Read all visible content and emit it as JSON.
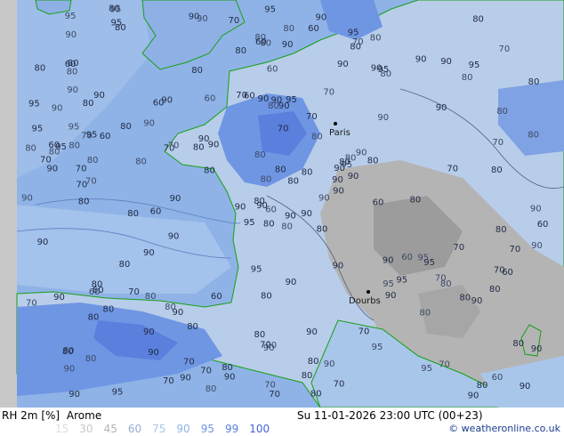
{
  "header": {
    "variable": "RH 2m [%]",
    "model": "Arome",
    "valid_time": "Su 11-01-2026 23:00 UTC (00+23)"
  },
  "legend": {
    "values": [
      "15",
      "30",
      "45",
      "60",
      "75",
      "90",
      "95",
      "99",
      "100"
    ],
    "colors": [
      "#dcdcdc",
      "#c9c9c9",
      "#b4b4b4",
      "#9aaed6",
      "#a8c6ea",
      "#8fb3e6",
      "#6f96e3",
      "#5a7fdd",
      "#4264d6"
    ]
  },
  "copyright": "© weatheronline.co.uk",
  "cities": [
    "Paris",
    "Dourbs"
  ],
  "colors": {
    "sea": "#8fb3e6",
    "land_high": "#6f96e3",
    "land_mid": "#b8cde9",
    "land_low": "#b4b4b4",
    "coast": "#16a016",
    "left_strip": "#c8c8c8"
  },
  "contour_labels": [
    "80",
    "80",
    "90",
    "80",
    "90",
    "90",
    "80",
    "95",
    "95",
    "90",
    "80",
    "90",
    "70",
    "80",
    "95",
    "90",
    "95",
    "90",
    "80",
    "80",
    "90",
    "90",
    "90",
    "90",
    "95",
    "95",
    "90",
    "80",
    "90",
    "90",
    "80",
    "80",
    "80",
    "80",
    "90",
    "90",
    "80",
    "80",
    "80",
    "95",
    "90",
    "80",
    "80",
    "90",
    "70",
    "80",
    "90",
    "90",
    "90",
    "90",
    "80",
    "80",
    "80",
    "95",
    "95",
    "90",
    "95",
    "95",
    "90",
    "95",
    "80",
    "90",
    "95",
    "90",
    "90",
    "80",
    "70",
    "80",
    "80",
    "70",
    "80",
    "70",
    "60",
    "70",
    "80",
    "90",
    "80",
    "90",
    "80",
    "80",
    "80",
    "80",
    "60",
    "60",
    "70",
    "80",
    "90",
    "70",
    "80",
    "70",
    "80",
    "60",
    "80",
    "80",
    "80",
    "80",
    "80",
    "70",
    "90",
    "80",
    "80",
    "90",
    "90",
    "70",
    "80",
    "80",
    "70",
    "80",
    "80",
    "80",
    "80",
    "80",
    "90",
    "90",
    "90",
    "90",
    "80",
    "70",
    "70",
    "70",
    "60",
    "80",
    "70",
    "60",
    "80",
    "90",
    "60",
    "90",
    "70",
    "90",
    "60",
    "70",
    "70",
    "80",
    "70",
    "80",
    "90",
    "80",
    "90",
    "90",
    "80",
    "80",
    "80",
    "90",
    "80",
    "80",
    "80",
    "95",
    "70",
    "60",
    "70",
    "60",
    "60",
    "80",
    "70",
    "60",
    "60",
    "70",
    "60",
    "70",
    "90",
    "90",
    "90",
    "95",
    "80",
    "95",
    "95",
    "90",
    "95",
    "90",
    "90",
    "90",
    "95",
    "95",
    "90",
    "90",
    "90",
    "95",
    "95",
    "95",
    "90",
    "90",
    "80",
    "80",
    "60",
    "60",
    "70",
    "70",
    "80",
    "60",
    "70",
    "60",
    "80",
    "90",
    "90",
    "90",
    "80",
    "60",
    "70",
    "70",
    "70"
  ]
}
